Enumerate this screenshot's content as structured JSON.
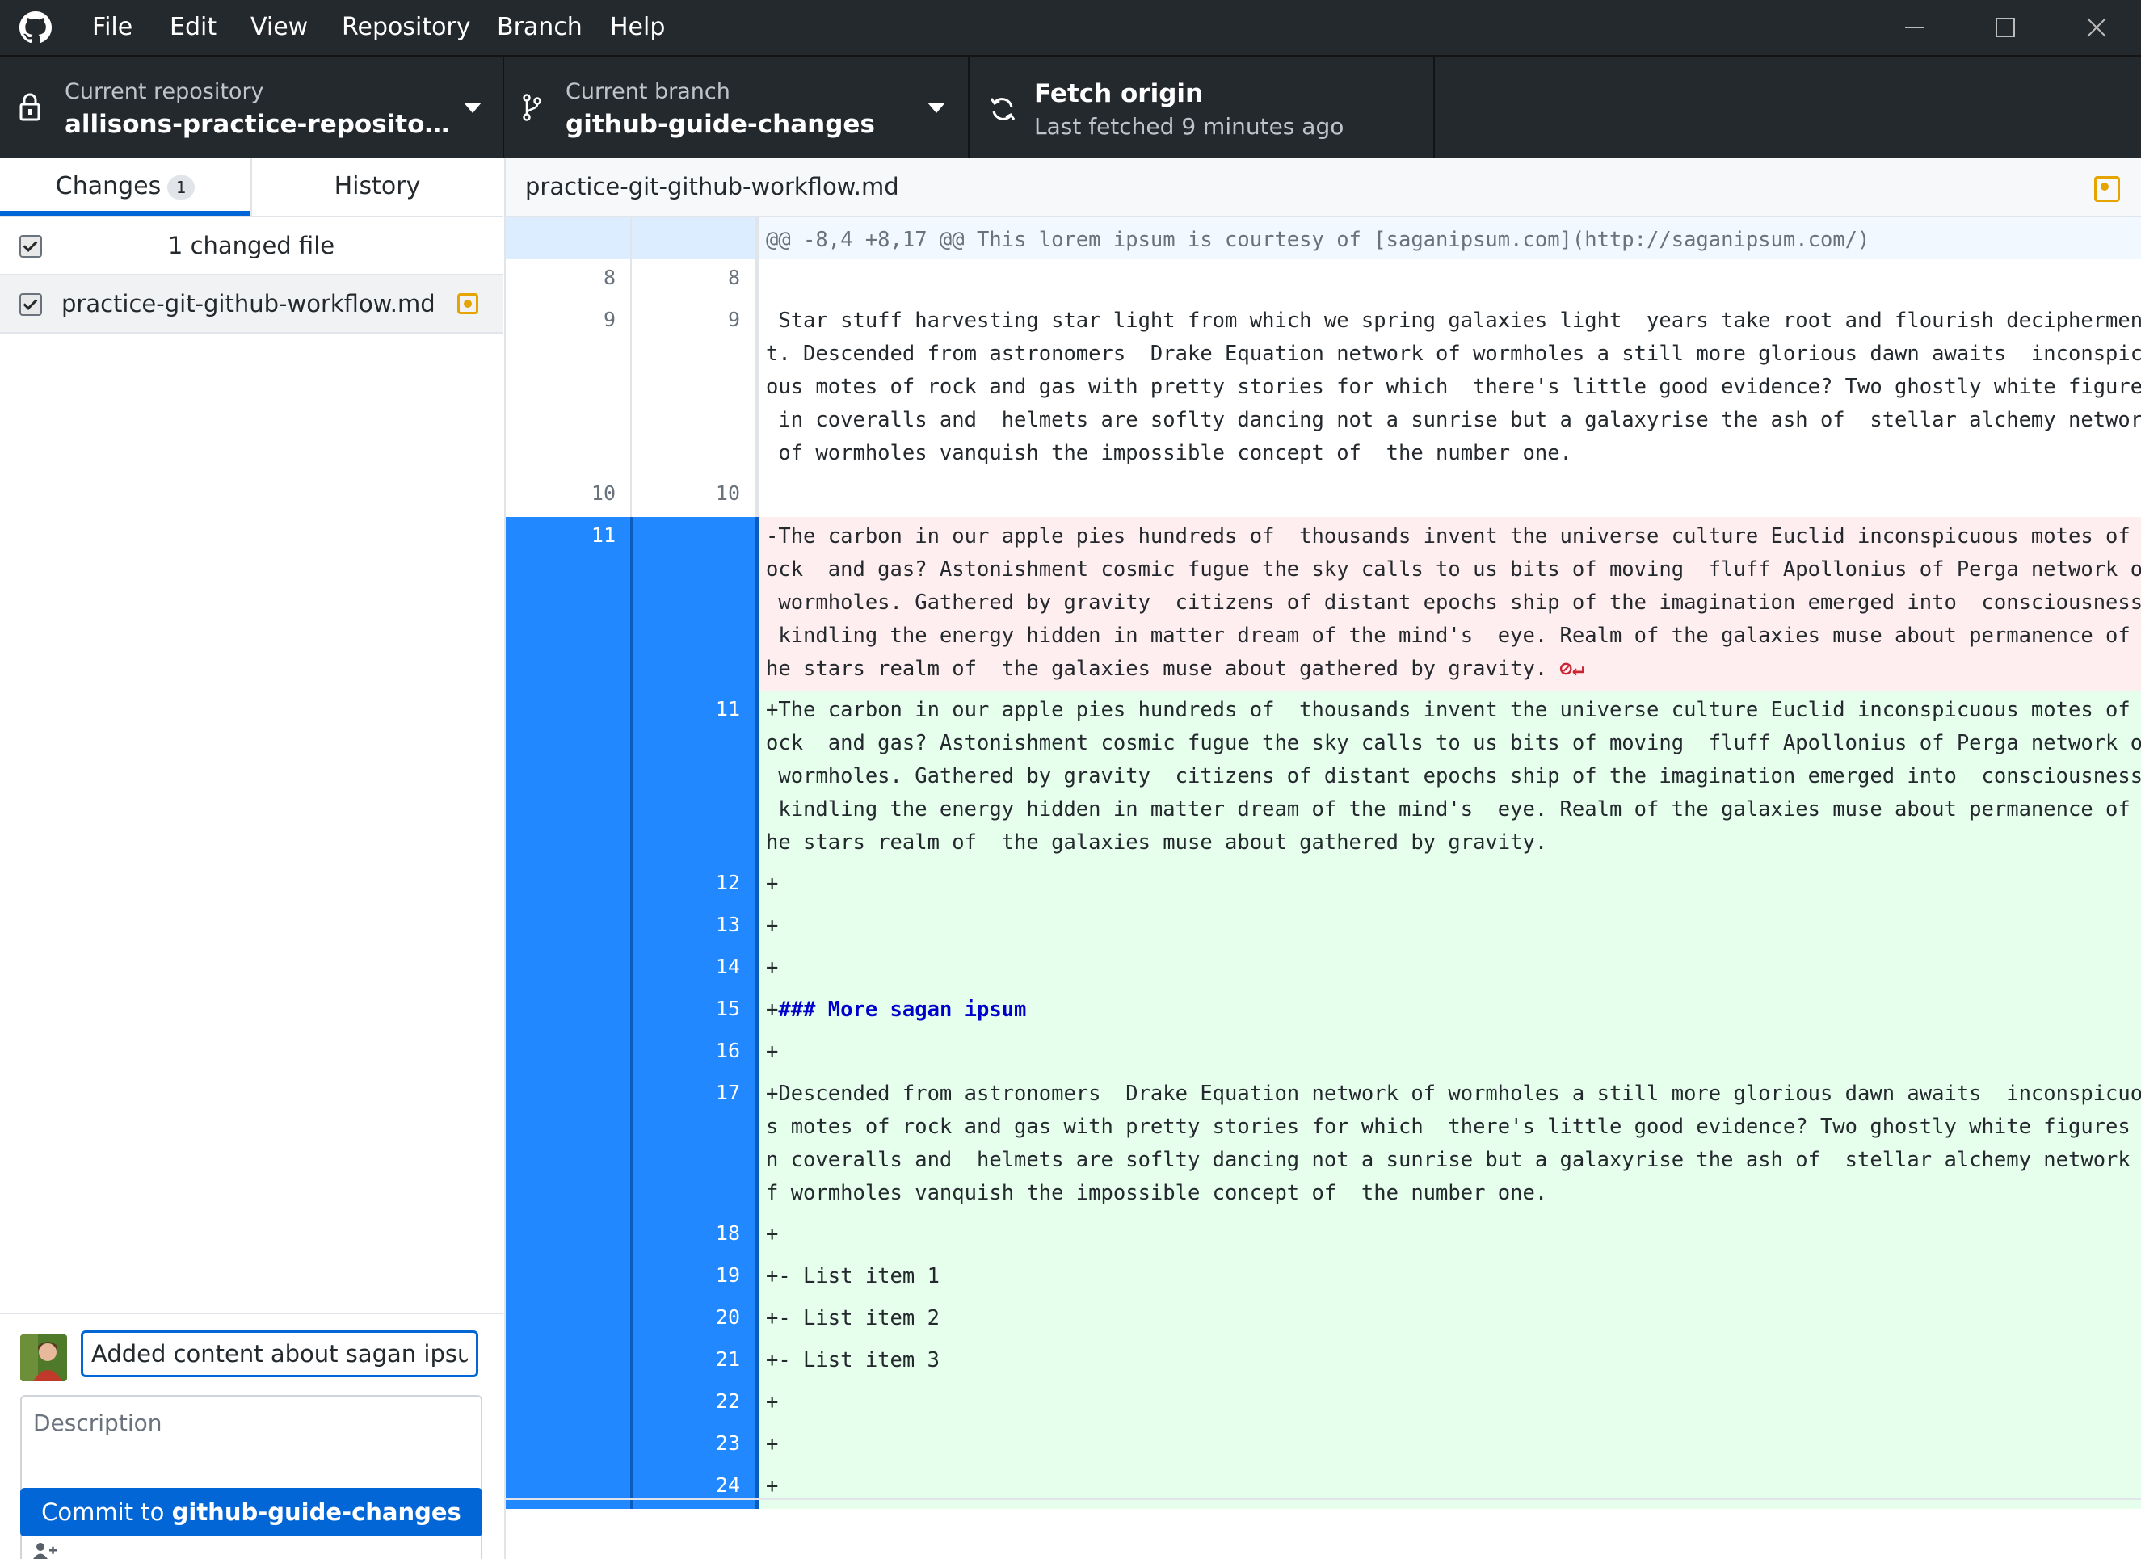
{
  "menu": [
    "File",
    "Edit",
    "View",
    "Repository",
    "Branch",
    "Help"
  ],
  "toolbar": {
    "repository": {
      "label": "Current repository",
      "value": "allisons-practice-repository-CPS..."
    },
    "branch": {
      "label": "Current branch",
      "value": "github-guide-changes"
    },
    "fetch": {
      "label": "Fetch origin",
      "value": "Last fetched 9 minutes ago"
    }
  },
  "sidebar": {
    "tabs": [
      {
        "label": "Changes",
        "count": "1"
      },
      {
        "label": "History"
      }
    ],
    "changed_files_summary": "1 changed file",
    "files": [
      {
        "name": "practice-git-github-workflow.md",
        "status": "modified"
      }
    ],
    "commit": {
      "summary": "Added content about sagan ipsum",
      "description_placeholder": "Description",
      "button_prefix": "Commit to ",
      "button_branch": "github-guide-changes"
    }
  },
  "diff": {
    "filename": "practice-git-github-workflow.md",
    "lines": [
      {
        "type": "hunk",
        "old": "",
        "new": "",
        "text": "@@ -8,4 +8,17 @@ This lorem ipsum is courtesy of [saganipsum.com](http://saganipsum.com/)"
      },
      {
        "type": "context",
        "old": "8",
        "new": "8",
        "text": ""
      },
      {
        "type": "context",
        "old": "9",
        "new": "9",
        "text": " Star stuff harvesting star light from which we spring galaxies light  years take root and flourish deciphermen\nt. Descended from astronomers  Drake Equation network of wormholes a still more glorious dawn awaits  inconspicu\nous motes of rock and gas with pretty stories for which  there's little good evidence? Two ghostly white figures\n in coveralls and  helmets are soflty dancing not a sunrise but a galaxyrise the ash of  stellar alchemy network\n of wormholes vanquish the impossible concept of  the number one."
      },
      {
        "type": "context",
        "old": "10",
        "new": "10",
        "text": ""
      },
      {
        "type": "del",
        "old": "11",
        "new": "",
        "text": "-The carbon in our apple pies hundreds of  thousands invent the universe culture Euclid inconspicuous motes of r\nock  and gas? Astonishment cosmic fugue the sky calls to us bits of moving  fluff Apollonius of Perga network of\n wormholes. Gathered by gravity  citizens of distant epochs ship of the imagination emerged into  consciousness\n kindling the energy hidden in matter dream of the mind's  eye. Realm of the galaxies muse about permanence of t\nhe stars realm of  the galaxies muse about gathered by gravity. ",
        "noeol": "⊘↵"
      },
      {
        "type": "add",
        "old": "",
        "new": "11",
        "text": "+The carbon in our apple pies hundreds of  thousands invent the universe culture Euclid inconspicuous motes of r\nock  and gas? Astonishment cosmic fugue the sky calls to us bits of moving  fluff Apollonius of Perga network of\n wormholes. Gathered by gravity  citizens of distant epochs ship of the imagination emerged into  consciousness\n kindling the energy hidden in matter dream of the mind's  eye. Realm of the galaxies muse about permanence of t\nhe stars realm of  the galaxies muse about gathered by gravity."
      },
      {
        "type": "add",
        "old": "",
        "new": "12",
        "text": "+"
      },
      {
        "type": "add",
        "old": "",
        "new": "13",
        "text": "+"
      },
      {
        "type": "add",
        "old": "",
        "new": "14",
        "text": "+"
      },
      {
        "type": "add",
        "old": "",
        "new": "15",
        "text": "+",
        "heading": "### More sagan ipsum"
      },
      {
        "type": "add",
        "old": "",
        "new": "16",
        "text": "+"
      },
      {
        "type": "add",
        "old": "",
        "new": "17",
        "text": "+Descended from astronomers  Drake Equation network of wormholes a still more glorious dawn awaits  inconspicuou\ns motes of rock and gas with pretty stories for which  there's little good evidence? Two ghostly white figures i\nn coveralls and  helmets are soflty dancing not a sunrise but a galaxyrise the ash of  stellar alchemy network o\nf wormholes vanquish the impossible concept of  the number one."
      },
      {
        "type": "add",
        "old": "",
        "new": "18",
        "text": "+"
      },
      {
        "type": "add",
        "old": "",
        "new": "19",
        "text": "+- List item 1"
      },
      {
        "type": "add",
        "old": "",
        "new": "20",
        "text": "+- List item 2"
      },
      {
        "type": "add",
        "old": "",
        "new": "21",
        "text": "+- List item 3"
      },
      {
        "type": "add",
        "old": "",
        "new": "22",
        "text": "+"
      },
      {
        "type": "add",
        "old": "",
        "new": "23",
        "text": "+"
      },
      {
        "type": "add",
        "old": "",
        "new": "24",
        "text": "+"
      }
    ]
  }
}
